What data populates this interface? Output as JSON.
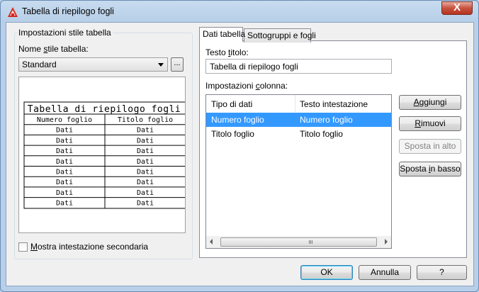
{
  "window": {
    "title": "Tabella di riepilogo fogli",
    "close_glyph": "X"
  },
  "left": {
    "group_title": "Impostazioni stile tabella",
    "style_name_label_pre": "Nome ",
    "style_name_label_hot": "s",
    "style_name_label_post": "tile tabella:",
    "style_value": "Standard",
    "browse_label": "...",
    "preview": {
      "title": "Tabella di riepilogo fogli",
      "headers": [
        "Numero foglio",
        "Titolo foglio"
      ],
      "cell": "Dati",
      "row_count": 8
    },
    "secondary_header_pre": "",
    "secondary_header_hot": "M",
    "secondary_header_post": "ostra intestazione secondaria"
  },
  "tabs": [
    {
      "label": "Dati tabella",
      "active": true
    },
    {
      "label": "Sottogruppi e fogli",
      "active": false
    }
  ],
  "data_tab": {
    "title_label_pre": "Testo ",
    "title_label_hot": "t",
    "title_label_post": "itolo:",
    "title_value": "Tabella di riepilogo fogli",
    "columns_label_pre": "Impostazioni ",
    "columns_label_hot": "c",
    "columns_label_post": "olonna:",
    "columns": {
      "headers": [
        "Tipo di dati",
        "Testo intestazione"
      ],
      "rows": [
        {
          "type": "Numero foglio",
          "heading": "Numero foglio",
          "selected": true
        },
        {
          "type": "Titolo foglio",
          "heading": "Titolo foglio",
          "selected": false
        }
      ]
    }
  },
  "buttons": {
    "add_pre": "",
    "add_hot": "A",
    "add_post": "ggiungi",
    "remove_pre": "",
    "remove_hot": "R",
    "remove_post": "imuovi",
    "move_up": "Sposta in alto",
    "move_down_pre": "Sposta ",
    "move_down_hot": "i",
    "move_down_post": "n basso",
    "ok": "OK",
    "cancel": "Annulla",
    "help": "?"
  }
}
